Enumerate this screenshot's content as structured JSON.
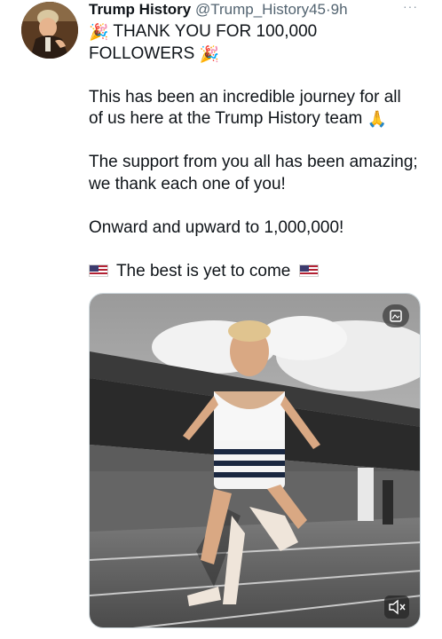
{
  "author": {
    "name": "Trump History",
    "handle": "@Trump_History45",
    "separator": "·",
    "time": "9h",
    "more": "···"
  },
  "tweet": {
    "line1": "THANK YOU FOR 100,000",
    "line2": "FOLLOWERS",
    "p2_line1": "This has been an incredible journey for all",
    "p2_line2": "of us here at the Trump History team",
    "p3_line1": "The support from you all has been amazing;",
    "p3_line2": "we thank each one of you!",
    "p4": "Onward and upward to 1,000,000!",
    "p5": "The best is yet to come"
  },
  "icons": {
    "party": "party-popper-icon",
    "pray": "folded-hands-icon",
    "flag": "us-flag-icon",
    "gif": "alt-media-icon",
    "mute": "volume-mute-icon"
  }
}
